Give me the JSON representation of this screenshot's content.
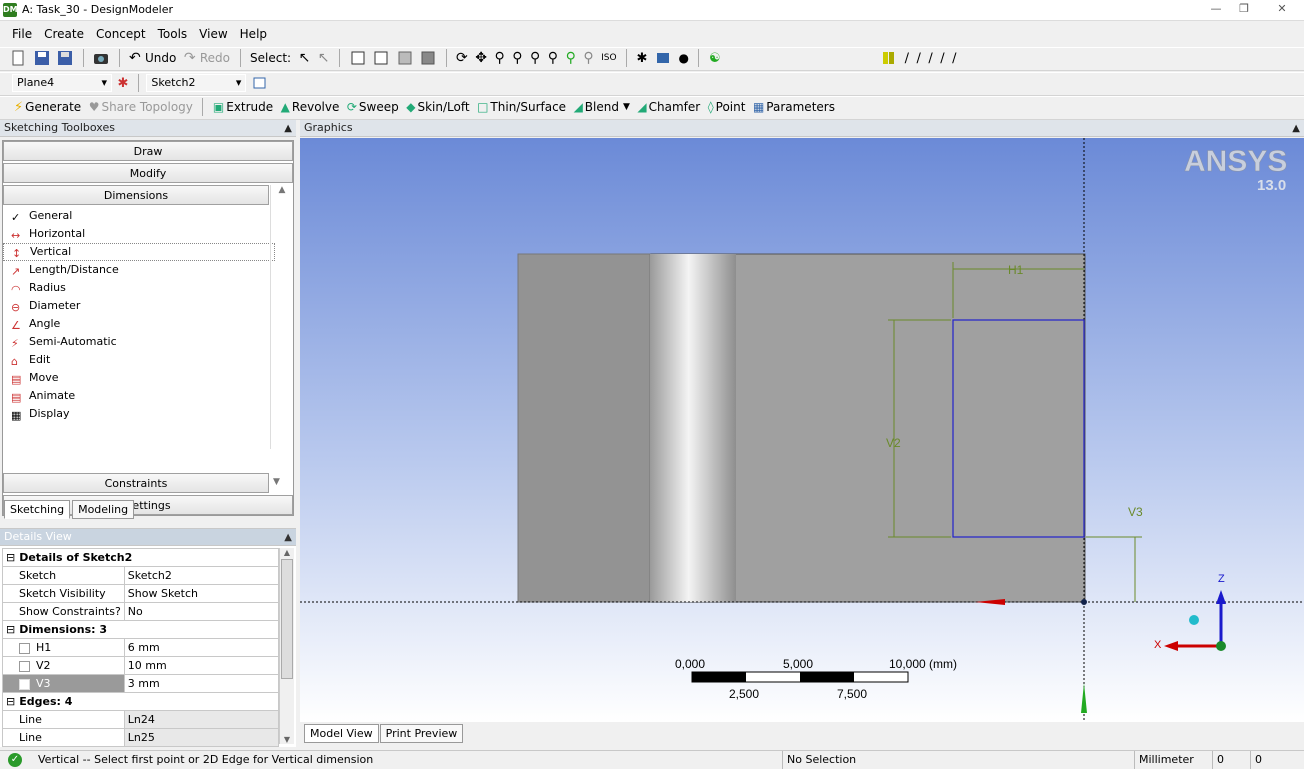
{
  "window": {
    "title": "A: Task_30 - DesignModeler",
    "app_icon": "DM"
  },
  "menu": [
    "File",
    "Create",
    "Concept",
    "Tools",
    "View",
    "Help"
  ],
  "toolbar1": {
    "undo": "Undo",
    "redo": "Redo",
    "select": "Select:"
  },
  "toolbar2": {
    "plane": "Plane4",
    "sketch": "Sketch2"
  },
  "toolbar3": {
    "generate": "Generate",
    "share_topology": "Share Topology",
    "extrude": "Extrude",
    "revolve": "Revolve",
    "sweep": "Sweep",
    "skin_loft": "Skin/Loft",
    "thin_surface": "Thin/Surface",
    "blend": "Blend",
    "chamfer": "Chamfer",
    "point": "Point",
    "parameters": "Parameters"
  },
  "toolbox": {
    "title": "Sketching Toolboxes",
    "draw": "Draw",
    "modify": "Modify",
    "dimensions": "Dimensions",
    "items": [
      "General",
      "Horizontal",
      "Vertical",
      "Length/Distance",
      "Radius",
      "Diameter",
      "Angle",
      "Semi-Automatic",
      "Edit",
      "Move",
      "Animate",
      "Display"
    ],
    "constraints": "Constraints",
    "settings": "Settings",
    "tabs": [
      "Sketching",
      "Modeling"
    ]
  },
  "details": {
    "title": "Details View",
    "header": "Details of Sketch2",
    "rows": [
      {
        "k": "Sketch",
        "v": "Sketch2"
      },
      {
        "k": "Sketch Visibility",
        "v": "Show Sketch"
      },
      {
        "k": "Show Constraints?",
        "v": "No"
      }
    ],
    "dims_header": "Dimensions: 3",
    "dims": [
      {
        "k": "H1",
        "v": "6 mm"
      },
      {
        "k": "V2",
        "v": "10 mm"
      },
      {
        "k": "V3",
        "v": "3 mm"
      }
    ],
    "edges_header": "Edges: 4",
    "edges": [
      {
        "k": "Line",
        "v": "Ln24"
      },
      {
        "k": "Line",
        "v": "Ln25"
      }
    ]
  },
  "graphics": {
    "title": "Graphics",
    "brand": "ANSYS",
    "version": "13.0",
    "dims": {
      "h1": "H1",
      "v2": "V2",
      "v3": "V3"
    },
    "scale": {
      "t0": "0,000",
      "t1": "5,000",
      "t2": "10,000 (mm)",
      "b1": "2,500",
      "b2": "7,500"
    },
    "axes": {
      "z": "Z",
      "x": "X"
    },
    "tabs": [
      "Model View",
      "Print Preview"
    ]
  },
  "status": {
    "message": "Vertical -- Select first point or 2D Edge for Vertical dimension",
    "selection": "No Selection",
    "unit": "Millimeter",
    "v1": "0",
    "v2": "0"
  }
}
